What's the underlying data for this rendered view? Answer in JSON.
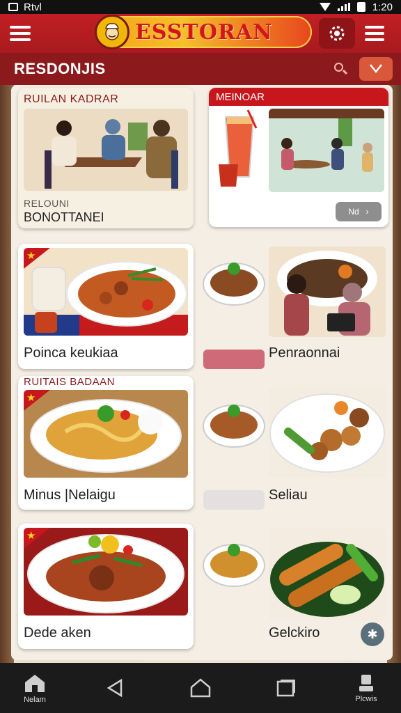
{
  "status_bar": {
    "carrier": "Rtvl",
    "time": "1:20"
  },
  "app_bar": {
    "brand": "ESSTORAN"
  },
  "section": {
    "title": "RESDONJIS"
  },
  "cards": {
    "c1": {
      "header": "RUILAN KADRAR",
      "sub": "RELOUNI",
      "label": "BONOTTANEI"
    },
    "c2": {
      "header": "MEINOAR",
      "button": "Nd"
    },
    "c3": {
      "label": "Poinca keukiaa"
    },
    "c4": {
      "label": "Penraonnai"
    },
    "c5": {
      "header": "RUITAIS BADAAN",
      "label": "Minus |Nelaigu"
    },
    "c6": {
      "label": "Seliau"
    },
    "c7": {
      "label": "Dede aken"
    },
    "c8": {
      "label": "Gelckiro"
    }
  },
  "nav": {
    "home": "Nelam",
    "profile": "Plcwis"
  },
  "colors": {
    "primary": "#c21f24",
    "dark_red": "#8c1a1c",
    "accent_orange": "#d9573a",
    "nav_bg": "#1b1b1b"
  },
  "icons": [
    "menu-icon",
    "gear-icon",
    "search-icon",
    "filter-icon",
    "back-icon",
    "home-icon",
    "recents-icon",
    "profile-icon",
    "accessibility-icon"
  ]
}
